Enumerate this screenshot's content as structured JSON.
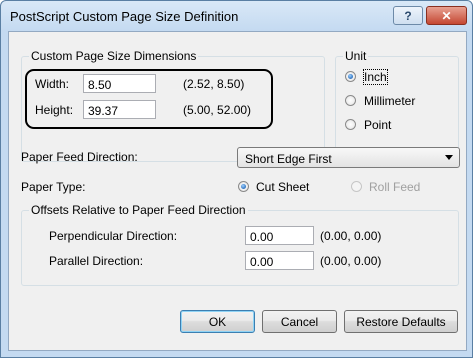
{
  "window": {
    "title": "PostScript Custom Page Size Definition",
    "help_label": "?",
    "close_label": "✕"
  },
  "size_group": {
    "title": "Custom Page Size Dimensions",
    "width_label": "Width:",
    "width_value": "8.50",
    "width_range": "(2.52, 8.50)",
    "height_label": "Height:",
    "height_value": "39.37",
    "height_range": "(5.00, 52.00)"
  },
  "unit_group": {
    "title": "Unit",
    "options": [
      {
        "label": "Inch",
        "selected": true
      },
      {
        "label": "Millimeter",
        "selected": false
      },
      {
        "label": "Point",
        "selected": false
      }
    ]
  },
  "paper_feed": {
    "label": "Paper Feed Direction:",
    "selected": "Short Edge First"
  },
  "paper_type": {
    "label": "Paper Type:",
    "options": [
      {
        "label": "Cut Sheet",
        "selected": true,
        "enabled": true
      },
      {
        "label": "Roll Feed",
        "selected": false,
        "enabled": false
      }
    ]
  },
  "offsets_group": {
    "title": "Offsets Relative to Paper Feed Direction",
    "perpendicular_label": "Perpendicular Direction:",
    "perpendicular_value": "0.00",
    "perpendicular_range": "(0.00, 0.00)",
    "parallel_label": "Parallel Direction:",
    "parallel_value": "0.00",
    "parallel_range": "(0.00, 0.00)"
  },
  "buttons": {
    "ok": "OK",
    "cancel": "Cancel",
    "restore": "Restore Defaults"
  }
}
